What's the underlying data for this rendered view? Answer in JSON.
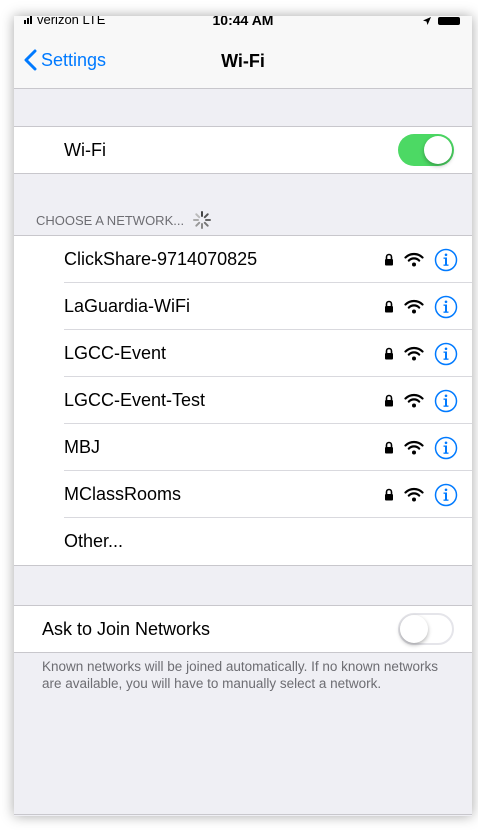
{
  "status_bar": {
    "carrier": "verizon  LTE",
    "time": "10:44 AM"
  },
  "nav": {
    "back_label": "Settings",
    "title": "Wi-Fi"
  },
  "wifi_toggle": {
    "label": "Wi-Fi",
    "state": "on"
  },
  "networks_section": {
    "header": "CHOOSE A NETWORK...",
    "networks": [
      {
        "name": "ClickShare-9714070825",
        "secured": true
      },
      {
        "name": "LaGuardia-WiFi",
        "secured": true
      },
      {
        "name": "LGCC-Event",
        "secured": true
      },
      {
        "name": "LGCC-Event-Test",
        "secured": true
      },
      {
        "name": "MBJ",
        "secured": true
      },
      {
        "name": "MClassRooms",
        "secured": true
      }
    ],
    "other_label": "Other..."
  },
  "ask_to_join": {
    "label": "Ask to Join Networks",
    "state": "off",
    "footer": "Known networks will be joined automatically. If no known networks are available, you will have to manually select a network."
  },
  "colors": {
    "accent": "#007aff",
    "toggle_on": "#4cd964",
    "background": "#efeff4"
  },
  "icons": [
    "signal-icon",
    "location-arrow-icon",
    "battery-icon",
    "chevron-left-icon",
    "spinner-icon",
    "lock-icon",
    "wifi-icon",
    "info-icon"
  ]
}
